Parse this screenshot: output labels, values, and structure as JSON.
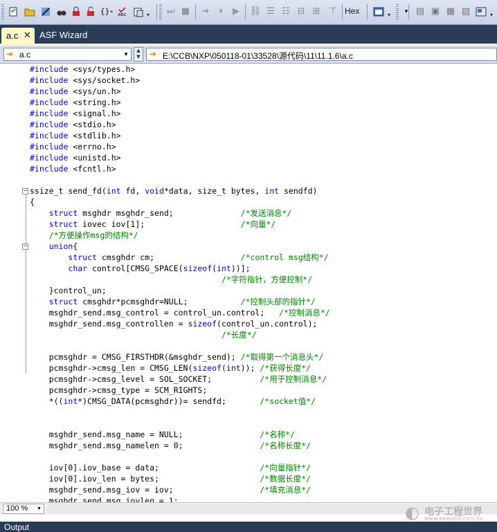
{
  "toolbar": {
    "hex_label": "Hex",
    "icons": [
      "checklist-icon",
      "open-folder-icon",
      "tools-icon",
      "binoculars-icon",
      "lock-icon",
      "unlock-icon",
      "bracket-icon",
      "spellcheck-icon",
      "paste-icon",
      "step-icon",
      "stop-icon",
      "forward-icon",
      "pause-icon",
      "play-icon",
      "link-icon",
      "indent-icon",
      "outdent-icon",
      "align-icon",
      "top-icon",
      "window-icon",
      "list-icon",
      "breakpoint-icon",
      "table-icon",
      "display-icon",
      "export-icon"
    ]
  },
  "tabs": [
    {
      "label": "a.c",
      "active": true
    },
    {
      "label": "ASF Wizard",
      "active": false
    }
  ],
  "navigation": {
    "scope_value": "a.c",
    "file_path": "E:\\CCB\\NXP\\050118-01\\33528\\源代码\\11\\11.1.6\\a.c"
  },
  "code_lines": [
    "#include <sys/types.h>",
    "#include <sys/socket.h>",
    "#include <sys/un.h>",
    "#include <string.h>",
    "#include <signal.h>",
    "#include <stdio.h>",
    "#include <stdlib.h>",
    "#include <errno.h>",
    "#include <unistd.h>",
    "#include <fcntl.h>",
    "",
    "ssize_t send_fd(int fd, void*data, size_t bytes, int sendfd)",
    "{",
    "    struct msghdr msghdr_send;              /*发送消息*/",
    "    struct iovec iov[1];                    /*向量*/",
    "    /*方便操作msg的结构*/",
    "    union{",
    "        struct cmsghdr cm;                  /*control msg结构*/",
    "        char control[CMSG_SPACE(sizeof(int))];",
    "                                        /*字符指针，方便控制*/",
    "    }control_un;",
    "    struct cmsghdr*pcmsghdr=NULL;           /*控制头部的指针*/",
    "    msghdr_send.msg_control = control_un.control;   /*控制消息*/",
    "    msghdr_send.msg_controllen = sizeof(control_un.control);",
    "                                        /*长度*/",
    "",
    "    pcmsghdr = CMSG_FIRSTHDR(&msghdr_send); /*取得第一个消息头*/",
    "    pcmsghdr->cmsg_len = CMSG_LEN(sizeof(int)); /*获得长度*/",
    "    pcmsghdr->cmsg_level = SOL_SOCKET;          /*用于控制消息*/",
    "    pcmsghdr->cmsg_type = SCM_RIGHTS;",
    "    *((int*)CMSG_DATA(pcmsghdr))= sendfd;       /*socket值*/",
    "",
    "",
    "    msghdr_send.msg_name = NULL;                /*名称*/",
    "    msghdr_send.msg_namelen = 0;                /*名称长度*/",
    "",
    "    iov[0].iov_base = data;                     /*向量指针*/",
    "    iov[0].iov_len = bytes;                     /*数据长度*/",
    "    msghdr_send.msg_iov = iov;                  /*填充消息*/",
    "    msghdr_send.msg_iovlen = 1;"
  ],
  "status": {
    "zoom_value": "100 %",
    "output_label": "Output"
  },
  "watermark": {
    "main": "电子工程世界",
    "sub": "www.eeworld.com.cn"
  },
  "colors": {
    "keyword": "#0000ff",
    "comment": "#008000",
    "tab_strip": "#2b3c59",
    "active_tab": "#fff6c9"
  }
}
